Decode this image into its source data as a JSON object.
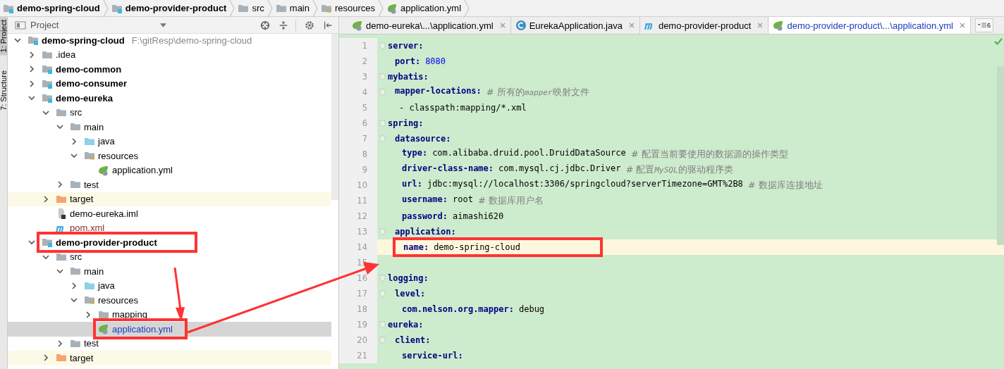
{
  "breadcrumbs": [
    {
      "label": "demo-spring-cloud",
      "kind": "module"
    },
    {
      "label": "demo-provider-product",
      "kind": "module"
    },
    {
      "label": "src",
      "kind": "folder"
    },
    {
      "label": "main",
      "kind": "folder"
    },
    {
      "label": "resources",
      "kind": "resources"
    },
    {
      "label": "application.yml",
      "kind": "spring"
    }
  ],
  "tool_strip": [
    {
      "label": "1: Project",
      "selected": true
    },
    {
      "label": "7: Structure",
      "selected": false
    }
  ],
  "project_panel": {
    "title": "Project",
    "tree": [
      {
        "label": "demo-spring-cloud",
        "kind": "module",
        "path": "F:\\gitResp\\demo-spring-cloud",
        "expanded": true,
        "selected": false,
        "annotated": false,
        "children": [
          {
            "label": ".idea",
            "kind": "folder",
            "expanded": false,
            "selected": false,
            "annotated": false
          },
          {
            "label": "demo-common",
            "kind": "module",
            "expanded": false,
            "selected": false,
            "annotated": false
          },
          {
            "label": "demo-consumer",
            "kind": "module",
            "expanded": false,
            "selected": false,
            "annotated": false
          },
          {
            "label": "demo-eureka",
            "kind": "module",
            "expanded": true,
            "selected": false,
            "annotated": false,
            "children": [
              {
                "label": "src",
                "kind": "folder",
                "expanded": true,
                "selected": false,
                "annotated": false,
                "children": [
                  {
                    "label": "main",
                    "kind": "folder",
                    "expanded": true,
                    "selected": false,
                    "annotated": false,
                    "children": [
                      {
                        "label": "java",
                        "kind": "source",
                        "expanded": false,
                        "selected": false,
                        "annotated": false
                      },
                      {
                        "label": "resources",
                        "kind": "resources",
                        "expanded": true,
                        "selected": false,
                        "annotated": false,
                        "children": [
                          {
                            "label": "application.yml",
                            "kind": "spring",
                            "selected": false,
                            "annotated": false
                          }
                        ]
                      }
                    ]
                  },
                  {
                    "label": "test",
                    "kind": "folder",
                    "expanded": false,
                    "selected": false,
                    "annotated": false
                  }
                ]
              },
              {
                "label": "target",
                "kind": "excluded",
                "expanded": false,
                "selected": false,
                "annotated": false
              },
              {
                "label": "demo-eureka.iml",
                "kind": "iml",
                "selected": false,
                "annotated": false
              },
              {
                "label": "pom.xml",
                "kind": "maven",
                "selected": false,
                "annotated": false
              }
            ]
          },
          {
            "label": "demo-provider-product",
            "kind": "module",
            "expanded": true,
            "selected": false,
            "annotated": true,
            "children": [
              {
                "label": "src",
                "kind": "folder",
                "expanded": true,
                "selected": false,
                "annotated": false,
                "children": [
                  {
                    "label": "main",
                    "kind": "folder",
                    "expanded": true,
                    "selected": false,
                    "annotated": false,
                    "children": [
                      {
                        "label": "java",
                        "kind": "source",
                        "expanded": false,
                        "selected": false,
                        "annotated": false
                      },
                      {
                        "label": "resources",
                        "kind": "resources",
                        "expanded": true,
                        "selected": false,
                        "annotated": false,
                        "children": [
                          {
                            "label": "mapping",
                            "kind": "folder",
                            "expanded": false,
                            "selected": false,
                            "annotated": false
                          },
                          {
                            "label": "application.yml",
                            "kind": "spring",
                            "selected": true,
                            "annotated": true
                          }
                        ]
                      }
                    ]
                  },
                  {
                    "label": "test",
                    "kind": "folder",
                    "expanded": false,
                    "selected": false,
                    "annotated": false
                  }
                ]
              },
              {
                "label": "target",
                "kind": "excluded",
                "expanded": false,
                "selected": false,
                "annotated": false
              }
            ]
          }
        ]
      }
    ]
  },
  "editor": {
    "tabs": [
      {
        "label": "demo-eureka\\...\\application.yml",
        "kind": "spring",
        "selected": false
      },
      {
        "label": "EurekaApplication.java",
        "kind": "java-class",
        "selected": false
      },
      {
        "label": "demo-provider-product",
        "kind": "maven",
        "selected": false
      },
      {
        "label": "demo-provider-product\\...\\application.yml",
        "kind": "spring",
        "selected": true
      }
    ],
    "tab_overflow_count": "6",
    "lines": [
      {
        "line": "1",
        "kind": "mapping",
        "key": "server:",
        "children": [
          {
            "line": "2",
            "kind": "number",
            "key": "port:",
            "value": "8080"
          }
        ]
      },
      {
        "line": "3",
        "kind": "mapping",
        "key": "mybatis:",
        "children": [
          {
            "line": "4",
            "kind": "mapping",
            "key": "mapper-locations:",
            "comment": [
              {
                "text": "# 所有的",
                "italic": false
              },
              {
                "text": "mapper",
                "italic": true
              },
              {
                "text": "映射文件",
                "italic": false
              }
            ],
            "children": [
              {
                "line": "5",
                "kind": "sequence-item",
                "value": "- classpath:mapping/*.xml"
              }
            ]
          }
        ]
      },
      {
        "line": "6",
        "kind": "mapping",
        "key": "spring:",
        "children": [
          {
            "line": "7",
            "kind": "mapping",
            "key": "datasource:",
            "children": [
              {
                "line": "8",
                "kind": "scalar",
                "key": "type:",
                "value": "com.alibaba.druid.pool.DruidDataSource",
                "comment": [
                  {
                    "text": "# 配置当前要使用的数据源的操作类型",
                    "italic": false
                  }
                ]
              },
              {
                "line": "9",
                "kind": "scalar",
                "key": "driver-class-name:",
                "value": "com.mysql.cj.jdbc.Driver",
                "comment": [
                  {
                    "text": "# 配置",
                    "italic": false
                  },
                  {
                    "text": "MySQL",
                    "italic": true
                  },
                  {
                    "text": "的驱动程序类",
                    "italic": false
                  }
                ]
              },
              {
                "line": "10",
                "kind": "scalar",
                "key": "url:",
                "value": "jdbc:mysql://localhost:3306/springcloud?serverTimezone=GMT%2B8",
                "comment": [
                  {
                    "text": "# 数据库连接地址",
                    "italic": false
                  }
                ]
              },
              {
                "line": "11",
                "kind": "scalar",
                "key": "username:",
                "value": "root",
                "comment": [
                  {
                    "text": "# 数据库用户名",
                    "italic": false
                  }
                ]
              },
              {
                "line": "12",
                "kind": "scalar",
                "key": "password:",
                "value": "aimashi620"
              }
            ]
          },
          {
            "line": "13",
            "kind": "mapping",
            "key": "application:",
            "children": [
              {
                "line": "14",
                "kind": "scalar",
                "key": "name:",
                "value": "demo-spring-cloud",
                "current": true,
                "annotated": true
              }
            ]
          }
        ]
      },
      {
        "line": "15",
        "kind": "blank"
      },
      {
        "line": "16",
        "kind": "mapping",
        "key": "logging:",
        "children": [
          {
            "line": "17",
            "kind": "mapping",
            "key": "level:",
            "children": [
              {
                "line": "18",
                "kind": "scalar",
                "key": "com.nelson.org.mapper:",
                "value": "debug"
              }
            ]
          }
        ]
      },
      {
        "line": "19",
        "kind": "mapping",
        "key": "eureka:",
        "children": [
          {
            "line": "20",
            "kind": "mapping",
            "key": "client:",
            "children": [
              {
                "line": "21",
                "kind": "mapping",
                "key": "service-url:"
              }
            ]
          }
        ]
      }
    ]
  }
}
